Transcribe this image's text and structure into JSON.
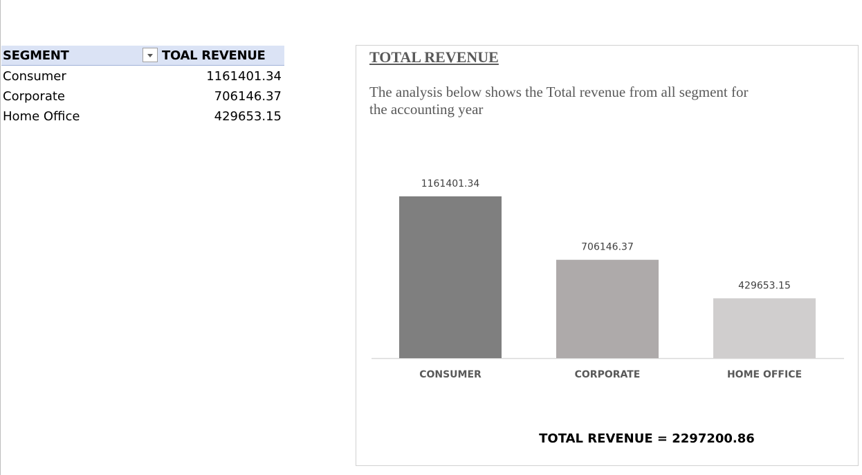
{
  "pivot": {
    "header_segment": "SEGMENT",
    "header_revenue": "TOAL REVENUE",
    "rows": [
      {
        "segment": "Consumer",
        "revenue": "1161401.34"
      },
      {
        "segment": "Corporate",
        "revenue": "706146.37"
      },
      {
        "segment": "Home Office",
        "revenue": "429653.15"
      }
    ]
  },
  "chart": {
    "title": "TOTAL REVENUE",
    "subtitle": "The analysis below shows the Total revenue from all segment for the accounting year",
    "total_text": "TOTAL REVENUE = 2297200.86"
  },
  "chart_data": {
    "type": "bar",
    "title": "TOTAL REVENUE",
    "categories": [
      "CONSUMER",
      "CORPORATE",
      "HOME OFFICE"
    ],
    "values": [
      1161401.34,
      706146.37,
      429653.15
    ],
    "data_labels": [
      "1161401.34",
      "706146.37",
      "429653.15"
    ],
    "colors": [
      "#7f7f7f",
      "#aeaaaa",
      "#d0cece"
    ],
    "xlabel": "",
    "ylabel": "",
    "grid": false,
    "legend": "none"
  }
}
